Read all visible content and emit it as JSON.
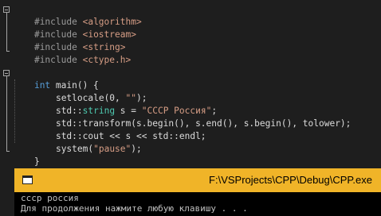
{
  "editor": {
    "includes": [
      {
        "directive": "#include",
        "header": "<algorithm>"
      },
      {
        "directive": "#include",
        "header": "<iostream>"
      },
      {
        "directive": "#include",
        "header": "<string>"
      },
      {
        "directive": "#include",
        "header": "<ctype.h>"
      }
    ],
    "main_sig": {
      "kw": "int",
      "rest": " main() {"
    },
    "body": {
      "l1_pre": "setlocale(0, ",
      "l1_str": "\"\"",
      "l1_post": ");",
      "l2_ns": "std::",
      "l2_type": "string",
      "l2_mid": " s = ",
      "l2_str": "\"СССР Россия\"",
      "l2_post": ";",
      "l3": "std::transform(s.begin(), s.end(), s.begin(), tolower);",
      "l4": "std::cout << s << std::endl;",
      "l5_pre": "system(",
      "l5_str": "\"pause\"",
      "l5_post": ");"
    },
    "close_brace": "}"
  },
  "console": {
    "title": "F:\\VSProjects\\CPP\\Debug\\CPP.exe",
    "lines": [
      "ссср россия",
      "Для продолжения нажмите любую клавишу . . ."
    ]
  }
}
